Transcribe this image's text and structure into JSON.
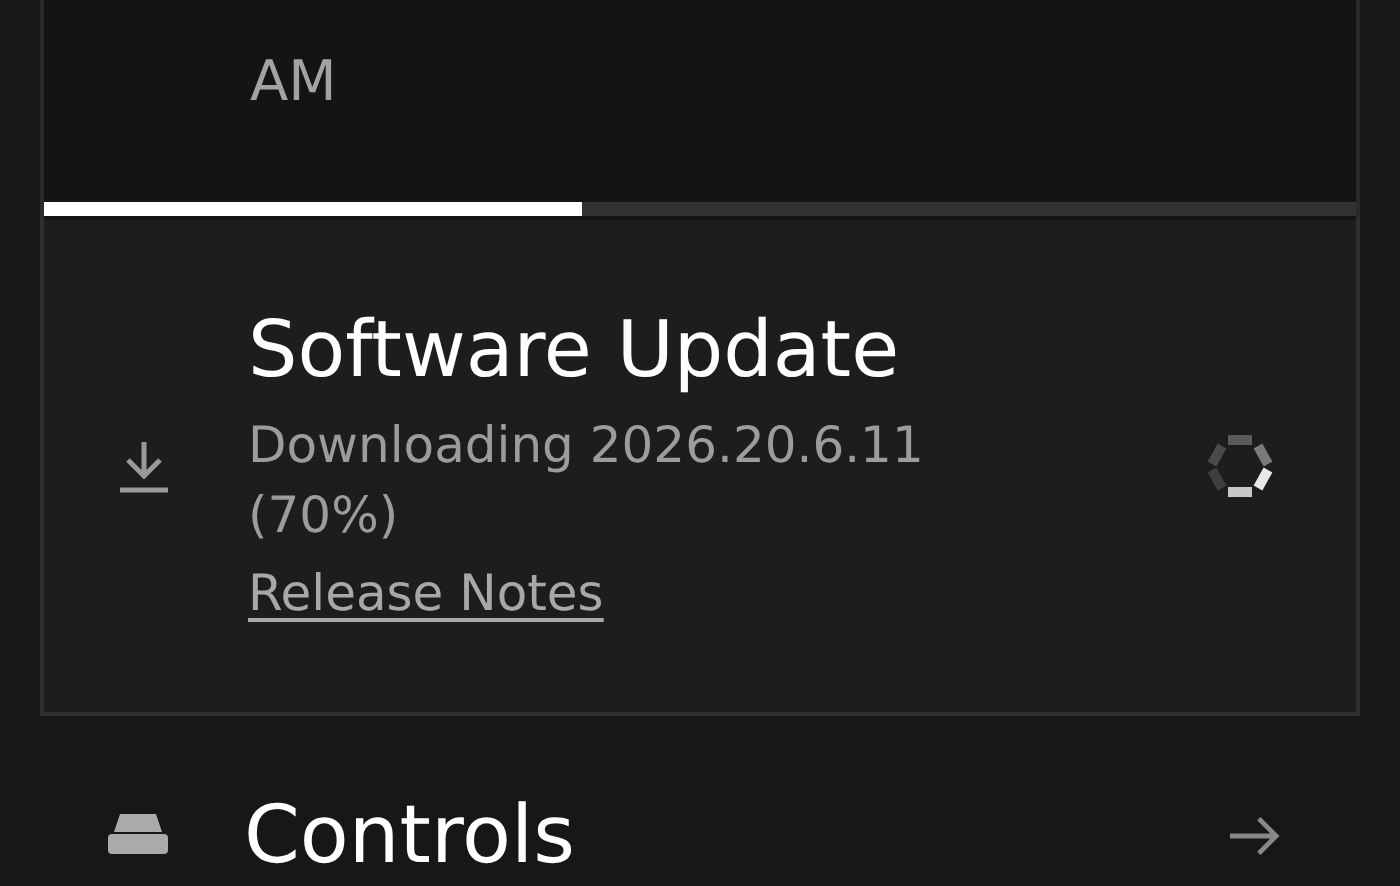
{
  "scheduled_card": {
    "time_tail": "AM",
    "progress": {
      "level": 0.41
    }
  },
  "software_update": {
    "title": "Software Update",
    "status": "Downloading 2026.20.6.11 (70%)",
    "link": "Release Notes"
  },
  "menu_items": [
    {
      "label": "Controls"
    }
  ]
}
